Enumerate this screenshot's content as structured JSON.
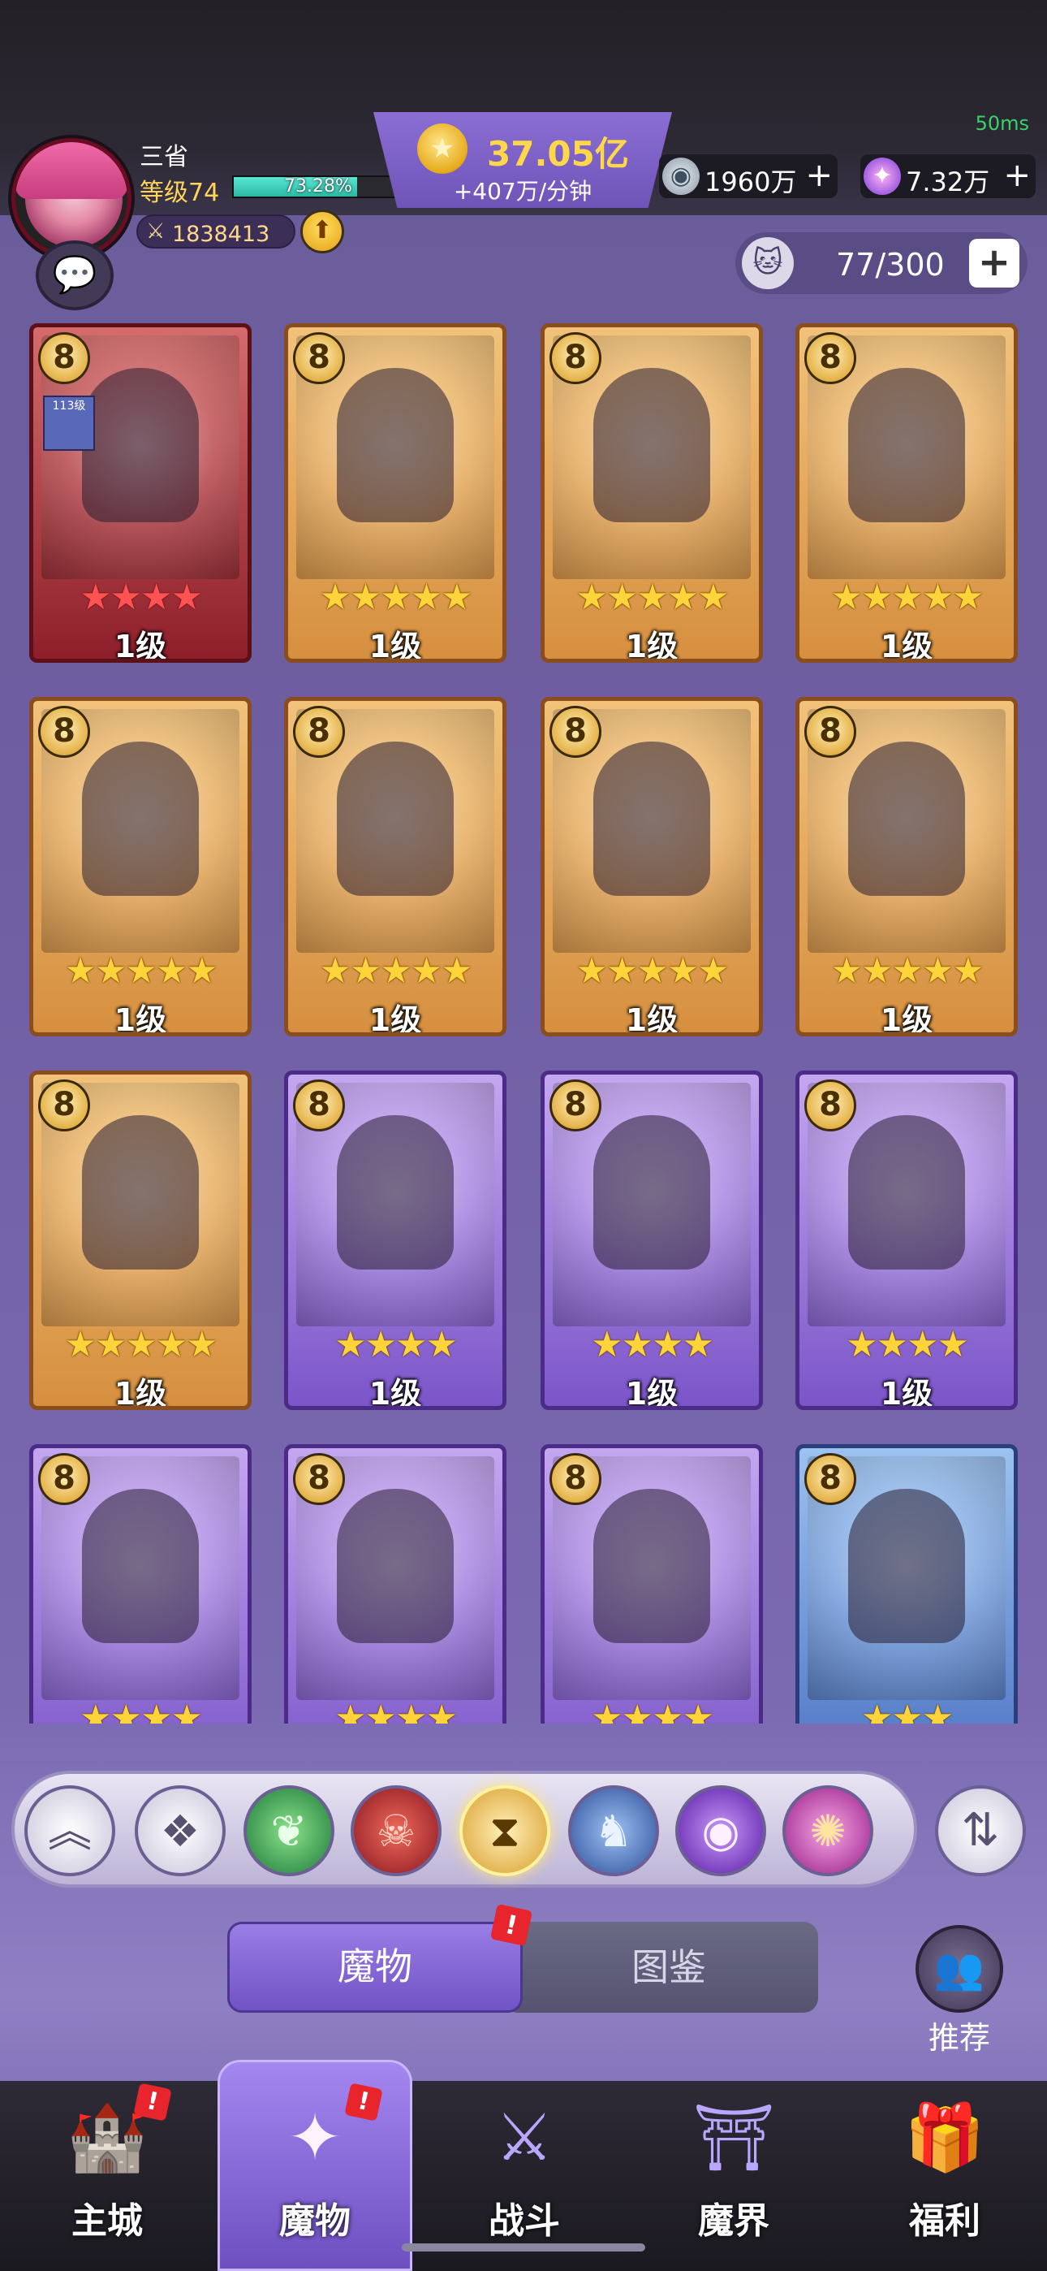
{
  "status": {
    "ping": "50ms"
  },
  "player": {
    "name": "三省",
    "level_label": "等级74",
    "exp_percent": "73.28%",
    "exp_fraction": 0.7328,
    "power": "1838413"
  },
  "currency": {
    "gold": "37.05亿",
    "gold_rate": "+407万/分钟",
    "silver": "1960万",
    "gems": "7.32万"
  },
  "capacity": {
    "text": "77/300"
  },
  "cards": [
    {
      "frame": "red",
      "stars": "★★★★",
      "star_color": "red",
      "level": "1级",
      "tag": "113级"
    },
    {
      "frame": "gold",
      "stars": "★★★★★",
      "star_color": "gold",
      "level": "1级"
    },
    {
      "frame": "gold",
      "stars": "★★★★★",
      "star_color": "gold",
      "level": "1级"
    },
    {
      "frame": "gold",
      "stars": "★★★★★",
      "star_color": "gold",
      "level": "1级"
    },
    {
      "frame": "gold",
      "stars": "★★★★★",
      "star_color": "gold",
      "level": "1级"
    },
    {
      "frame": "gold",
      "stars": "★★★★★",
      "star_color": "gold",
      "level": "1级"
    },
    {
      "frame": "gold",
      "stars": "★★★★★",
      "star_color": "gold",
      "level": "1级"
    },
    {
      "frame": "gold",
      "stars": "★★★★★",
      "star_color": "gold",
      "level": "1级"
    },
    {
      "frame": "gold",
      "stars": "★★★★★",
      "star_color": "gold",
      "level": "1级"
    },
    {
      "frame": "purple",
      "stars": "★★★★",
      "star_color": "gold",
      "level": "1级"
    },
    {
      "frame": "purple",
      "stars": "★★★★",
      "star_color": "gold",
      "level": "1级"
    },
    {
      "frame": "purple",
      "stars": "★★★★",
      "star_color": "gold",
      "level": "1级"
    },
    {
      "frame": "purple",
      "stars": "★★★★",
      "star_color": "gold",
      "level": ""
    },
    {
      "frame": "purple",
      "stars": "★★★★",
      "star_color": "gold",
      "level": ""
    },
    {
      "frame": "purple",
      "stars": "★★★★",
      "star_color": "gold",
      "level": ""
    },
    {
      "frame": "blue",
      "stars": "★★★",
      "star_color": "gold",
      "level": ""
    }
  ],
  "filters": [
    "up-arrows-icon",
    "all-icon",
    "nature-icon",
    "demon-icon",
    "hourglass-icon",
    "dragon-icon",
    "eye-icon",
    "chaos-icon"
  ],
  "tabs": {
    "monsters": "魔物",
    "codex": "图鉴"
  },
  "recommend": {
    "label": "推荐"
  },
  "nav": [
    {
      "label": "主城",
      "icon": "castle-icon",
      "alert": "!"
    },
    {
      "label": "魔物",
      "icon": "monster-icon",
      "alert": "!"
    },
    {
      "label": "战斗",
      "icon": "sword-icon"
    },
    {
      "label": "魔界",
      "icon": "portal-icon"
    },
    {
      "label": "福利",
      "icon": "chest-icon"
    }
  ],
  "colors": {
    "accent": "#7153c5",
    "gold_text": "#ffd84a",
    "alert": "#e8242c"
  }
}
